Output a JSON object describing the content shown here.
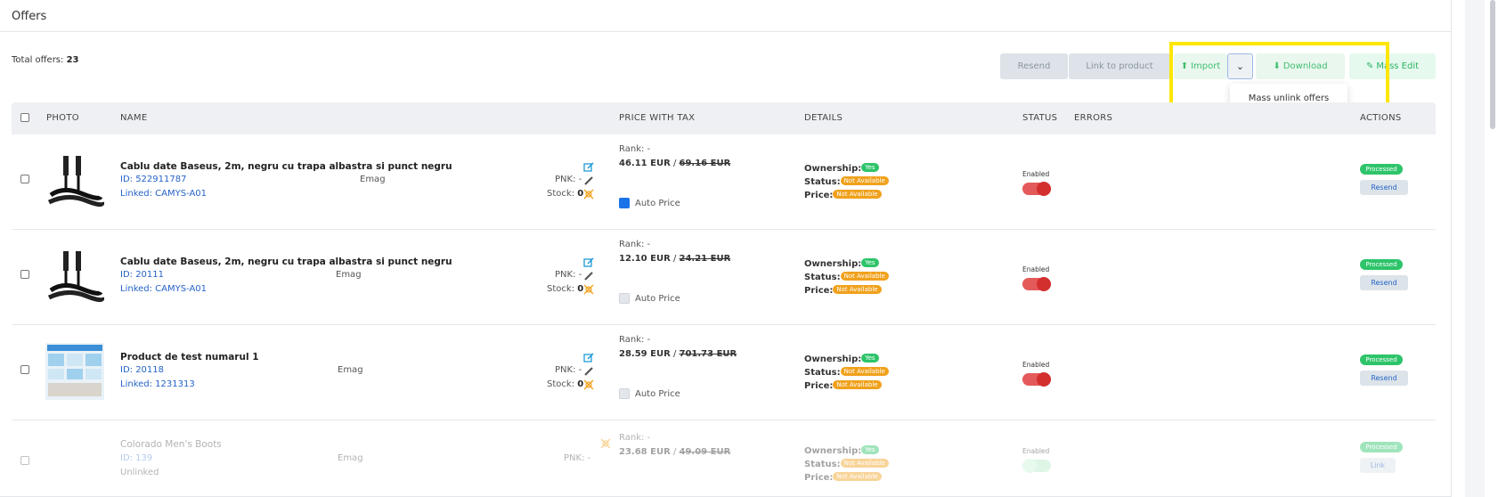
{
  "header": {
    "title": "Offers"
  },
  "summary": {
    "label": "Total offers:",
    "count": "23"
  },
  "toolbar": {
    "resend": "Resend",
    "link_to_product": "Link to product",
    "import": "Import",
    "download": "Download",
    "mass_edit": "Mass Edit",
    "dropdown_option": "Mass unlink offers"
  },
  "columns": {
    "photo": "PHOTO",
    "name": "NAME",
    "price": "PRICE WITH TAX",
    "details": "DETAILS",
    "status": "STATUS",
    "errors": "ERRORS",
    "actions": "ACTIONS"
  },
  "labels": {
    "pnk": "PNK:",
    "stock": "Stock:",
    "rank": "Rank:",
    "auto_price": "Auto Price",
    "ownership": "Ownership:",
    "status": "Status:",
    "price": "Price:",
    "enabled": "Enabled",
    "processed": "Processed"
  },
  "rows": [
    {
      "name": "Cablu date Baseus, 2m, negru cu trapa albastra si punct negru",
      "id": "ID: 522911787",
      "linked": "Linked: CAMYS-A01",
      "marketplace": "Emag",
      "pnk": "-",
      "stock": "0",
      "rank": "-",
      "price": "46.11 EUR",
      "old_price": "69.16 EUR",
      "auto_price": true,
      "ownership": "Yes",
      "status": "Not Available",
      "price_status": "Not Available",
      "action": "Resend"
    },
    {
      "name": "Cablu date Baseus, 2m, negru cu trapa albastra si punct negru",
      "id": "ID: 20111",
      "linked": "Linked: CAMYS-A01",
      "marketplace": "Emag",
      "pnk": "-",
      "stock": "0",
      "rank": "-",
      "price": "12.10 EUR",
      "old_price": "24.21 EUR",
      "auto_price": false,
      "ownership": "Yes",
      "status": "Not Available",
      "price_status": "Not Available",
      "action": "Resend"
    },
    {
      "name": "Product de test numarul 1",
      "id": "ID: 20118",
      "linked": "Linked: 1231313",
      "marketplace": "Emag",
      "pnk": "-",
      "stock": "0",
      "rank": "-",
      "price": "28.59 EUR",
      "old_price": "701.73 EUR",
      "auto_price": false,
      "ownership": "Yes",
      "status": "Not Available",
      "price_status": "Not Available",
      "action": "Resend"
    },
    {
      "name": "Colorado Men's Boots",
      "id": "ID: 139",
      "linked": "Unlinked",
      "marketplace": "Emag",
      "pnk": "-",
      "rank": "-",
      "price": "23.68 EUR",
      "old_price": "49.09 EUR",
      "ownership": "Yes",
      "status": "Not Available",
      "price_status": "Not Available",
      "action": "Link"
    }
  ],
  "sep": " / "
}
